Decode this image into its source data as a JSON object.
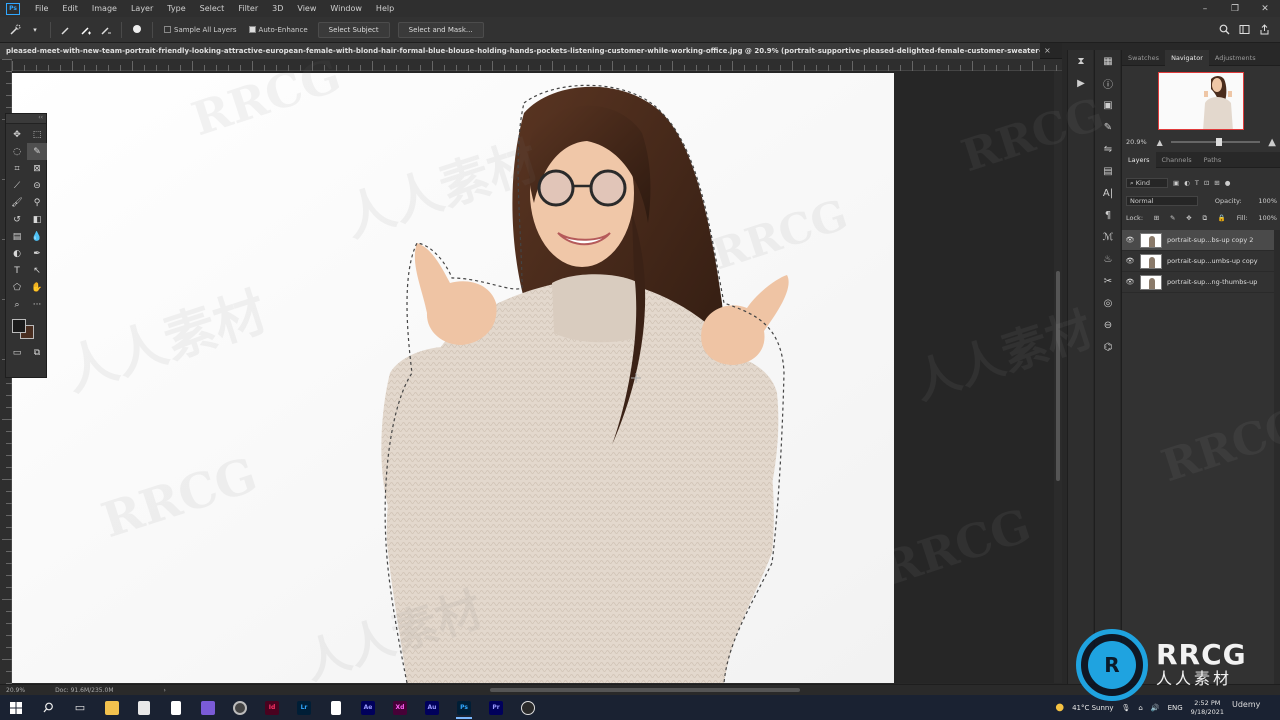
{
  "menubar": {
    "logo": "Ps",
    "items": [
      "File",
      "Edit",
      "Image",
      "Layer",
      "Type",
      "Select",
      "Filter",
      "3D",
      "View",
      "Window",
      "Help"
    ],
    "window_controls": [
      "–",
      "❐",
      "✕"
    ]
  },
  "options": {
    "sample_all_layers": "Sample All Layers",
    "auto_enhance": "Auto-Enhance",
    "select_subject": "Select Subject",
    "select_and_mask": "Select and Mask..."
  },
  "document": {
    "tab_title": "pleased-meet-with-new-team-portrait-friendly-looking-attractive-european-female-with-blond-hair-formal-blue-blouse-holding-hands-pockets-listening-customer-while-working-office.jpg @ 20.9% (portrait-supportive-pleased-delighted-female-customer-sweater-glasses-giving-thumbs-up c...",
    "close": "×"
  },
  "panels": {
    "top_tabs": [
      "Swatches",
      "Navigator",
      "Adjustments"
    ],
    "top_active": "Navigator",
    "zoom": "20.9%",
    "zoom_fraction": 0.5,
    "layer_tabs": [
      "Layers",
      "Channels",
      "Paths"
    ],
    "layer_active": "Layers",
    "kind_label": "Kind",
    "blend_mode": "Normal",
    "opacity_label": "Opacity:",
    "opacity_value": "100%",
    "lock_label": "Lock:",
    "fill_label": "Fill:",
    "fill_value": "100%",
    "layers": [
      {
        "name": "portrait-sup...bs-up copy 2",
        "selected": true
      },
      {
        "name": "portrait-sup...umbs-up copy",
        "selected": false
      },
      {
        "name": "portrait-sup...ng-thumbs-up",
        "selected": false
      }
    ]
  },
  "statusbar": {
    "zoom": "20.9%",
    "doc": "Doc: 91.6M/235.0M"
  },
  "taskbar": {
    "apps": [
      {
        "label": "",
        "color": "#ffffff",
        "name": "start-icon"
      },
      {
        "label": "⌕",
        "color": "#1a2232",
        "name": "search-icon"
      },
      {
        "label": "▭",
        "color": "#1a2232",
        "name": "task-view-icon"
      },
      {
        "label": "",
        "color": "#f2c14e",
        "name": "file-explorer-icon"
      },
      {
        "label": "",
        "color": "#e8e8e8",
        "name": "store-icon"
      },
      {
        "label": "",
        "color": "#ffffff",
        "name": "notes-icon"
      },
      {
        "label": "",
        "color": "#7a5bd6",
        "name": "app-purple-icon"
      },
      {
        "label": "",
        "color": "#6b5aa0",
        "name": "obs-icon"
      },
      {
        "label": "Id",
        "color": "#49021f",
        "name": "indesign-icon"
      },
      {
        "label": "Lr",
        "color": "#001e36",
        "name": "lightroom-icon"
      },
      {
        "label": "",
        "color": "#ffffff",
        "name": "document-icon"
      },
      {
        "label": "Ae",
        "color": "#00005b",
        "name": "after-effects-icon"
      },
      {
        "label": "Xd",
        "color": "#470137",
        "name": "xd-icon"
      },
      {
        "label": "Au",
        "color": "#00005b",
        "name": "audition-icon"
      },
      {
        "label": "Ps",
        "color": "#001e36",
        "name": "photoshop-icon"
      },
      {
        "label": "Pr",
        "color": "#00005b",
        "name": "premiere-icon"
      },
      {
        "label": "",
        "color": "#2a2a2a",
        "name": "github-icon"
      }
    ],
    "weather": "41°C  Sunny",
    "lang": "ENG",
    "time": "2:52 PM",
    "date": "9/18/2021"
  },
  "watermark": {
    "text": "RRCG",
    "cn": "人人素材",
    "logo_big": "RRCG",
    "logo_small": "人人素材",
    "udemy": "Udemy"
  },
  "colors": {
    "accent": "#31a8ff",
    "foreground": "#1b1b1b",
    "background": "#4a2e20",
    "sweater": "#e2d7cc",
    "hair": "#4a2c1c"
  }
}
